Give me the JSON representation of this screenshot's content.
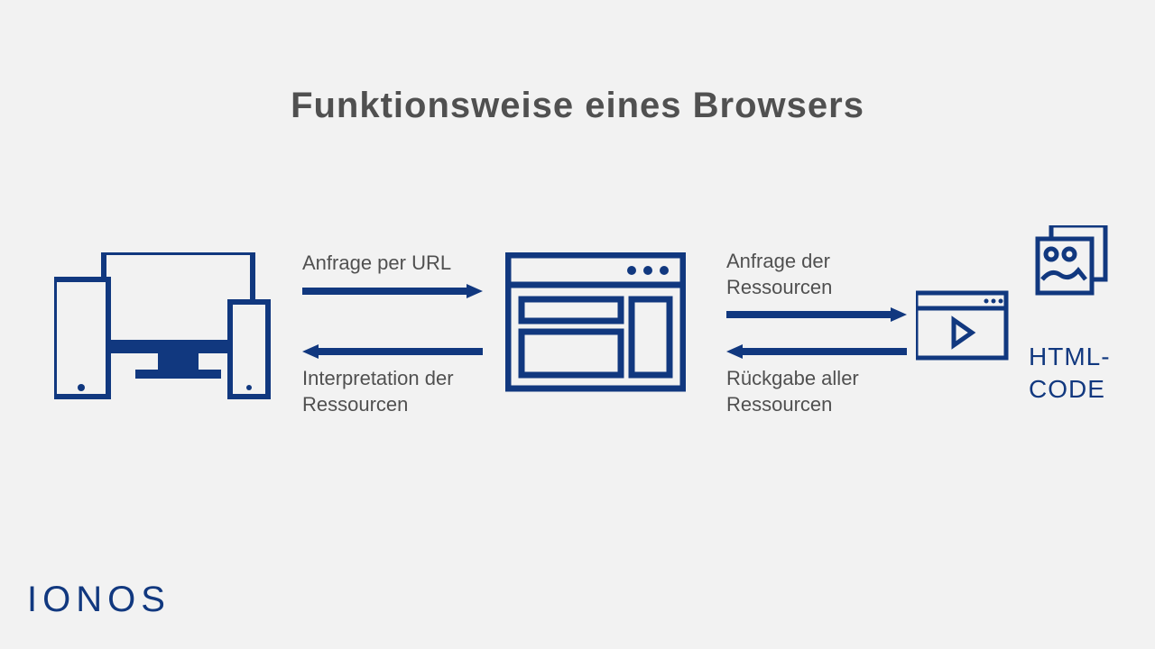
{
  "title": "Funktionsweise eines Browsers",
  "arrows": {
    "request_url": "Anfrage per URL",
    "interpret_resources": "Interpretation der Ressourcen",
    "request_resources": "Anfrage der Ressourcen",
    "return_resources": "Rückgabe aller Ressourcen"
  },
  "resources_label_line1": "HTML-",
  "resources_label_line2": "CODE",
  "brand": "IONOS",
  "colors": {
    "primary": "#11387f",
    "text": "#505050",
    "bg": "#f2f2f2"
  }
}
